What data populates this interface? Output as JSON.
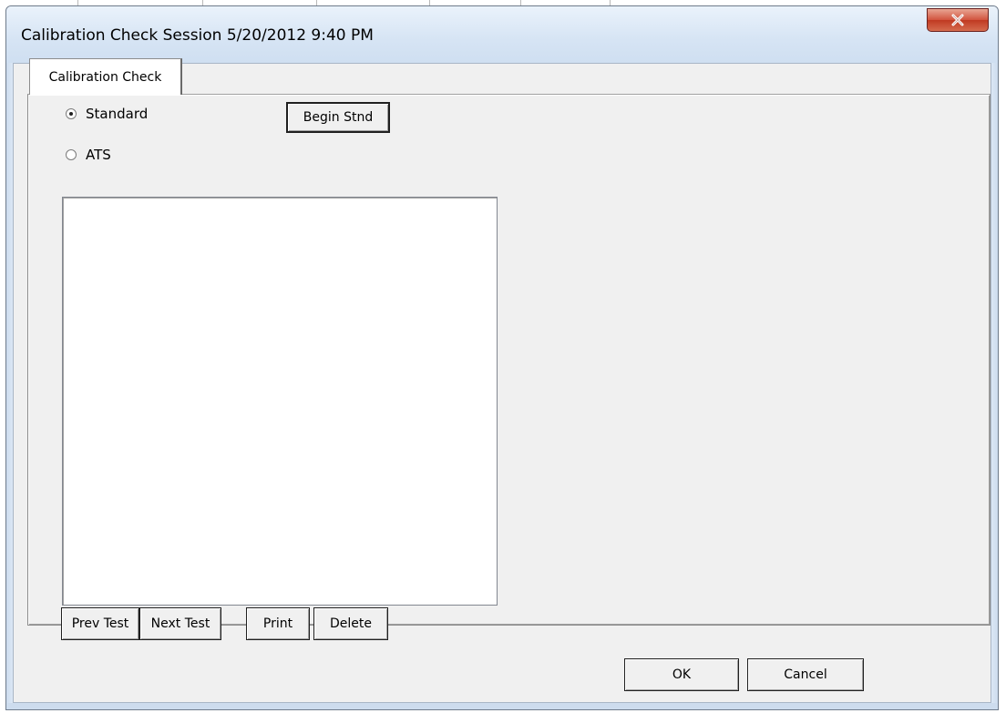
{
  "window": {
    "title": "Calibration Check Session 5/20/2012 9:40 PM",
    "close_glyph": "✕"
  },
  "tabs": [
    {
      "label": "Calibration Check",
      "active": true
    }
  ],
  "mode": {
    "options": [
      {
        "label": "Standard",
        "checked": true
      },
      {
        "label": "ATS",
        "checked": false
      }
    ]
  },
  "buttons": {
    "begin": "Begin Stnd",
    "prev": "Prev Test",
    "next": "Next Test",
    "print": "Print",
    "delete": "Delete",
    "ok": "OK",
    "cancel": "Cancel"
  },
  "results_list": {
    "items": []
  },
  "colors": {
    "close_button": "#c8452c",
    "dialog_face": "#f0f0f0",
    "frame": "#dbe7f5"
  }
}
